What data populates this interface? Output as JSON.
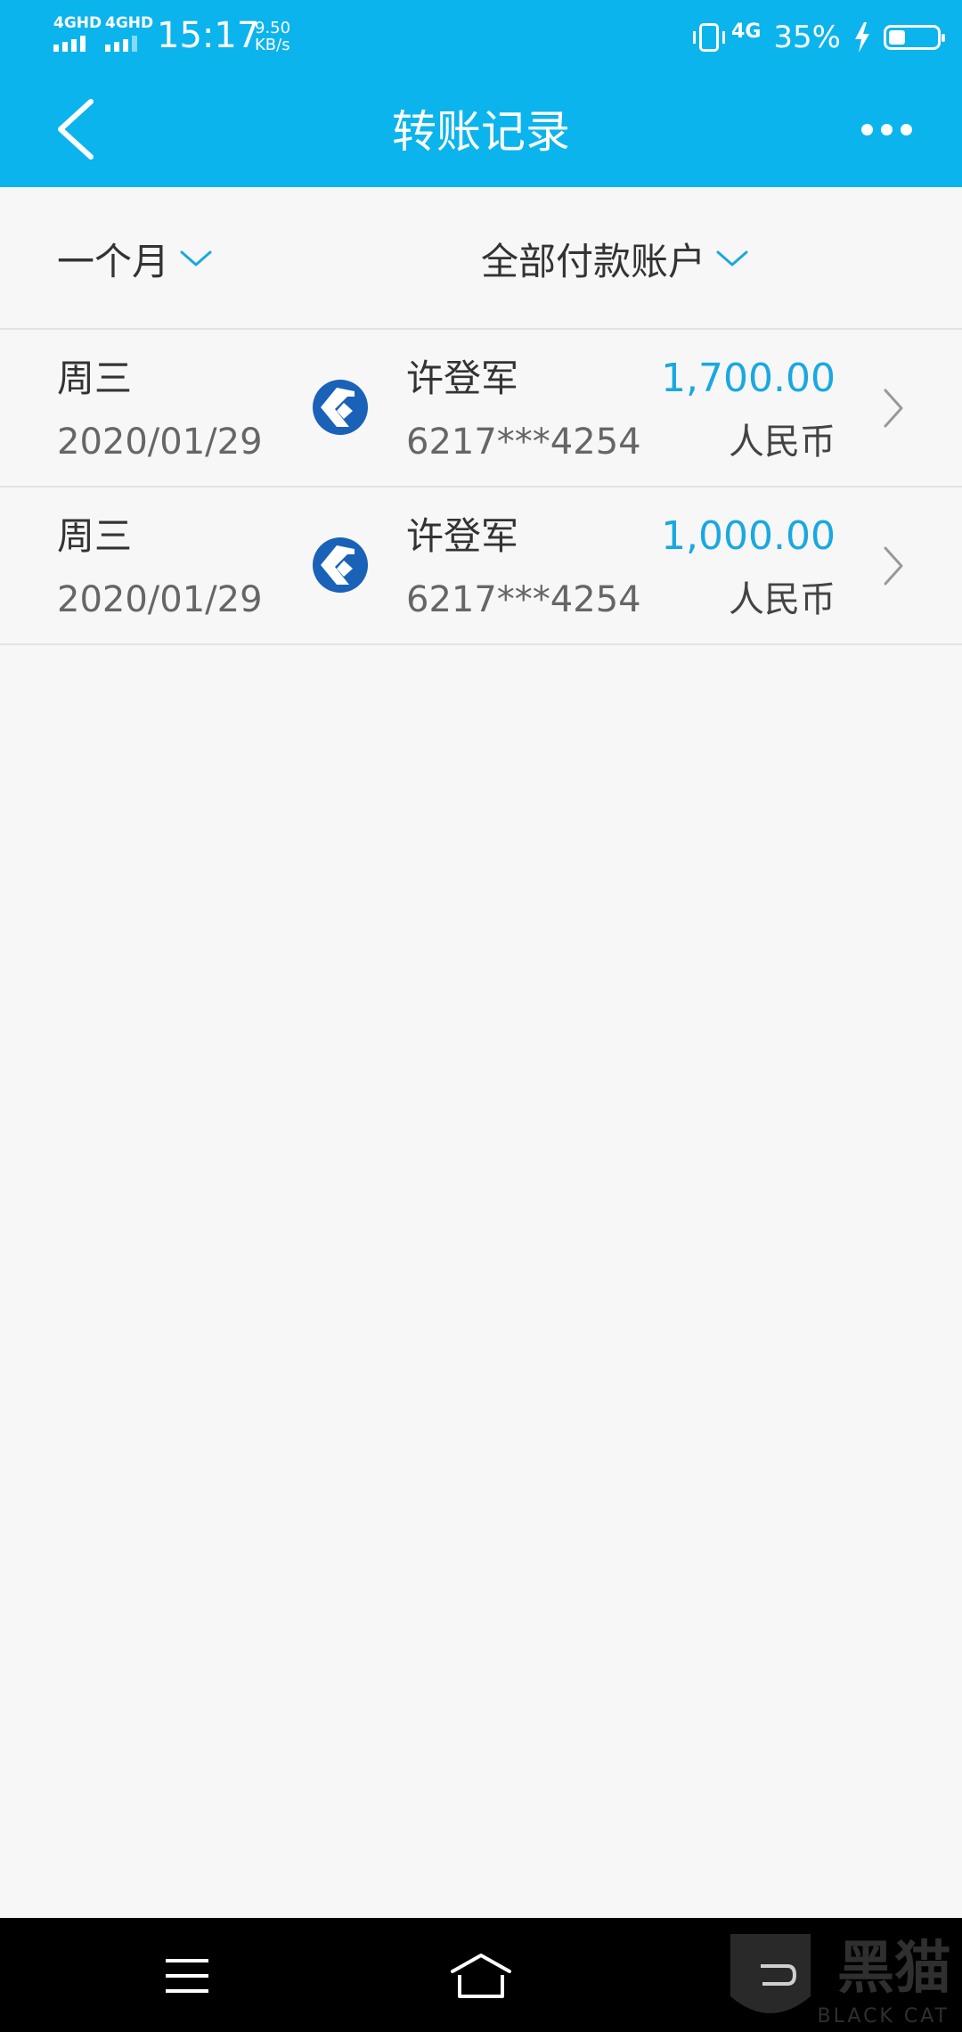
{
  "status_bar": {
    "sim1_label": "4GHD",
    "sim2_label": "4GHD",
    "time": "15:17",
    "speed_value": "9.50",
    "speed_unit": "KB/s",
    "network": "4G",
    "battery_text": "35%",
    "battery_level": 0.35
  },
  "header": {
    "title": "转账记录",
    "back_icon": "chevron-left-icon",
    "more_icon": "more-horizontal-icon"
  },
  "filters": {
    "period_label": "一个月",
    "account_label": "全部付款账户"
  },
  "transfers": [
    {
      "weekday": "周三",
      "date": "2020/01/29",
      "payee": "许登军",
      "account": "6217***4254",
      "amount": "1,700.00",
      "currency": "人民币"
    },
    {
      "weekday": "周三",
      "date": "2020/01/29",
      "payee": "许登军",
      "account": "6217***4254",
      "amount": "1,000.00",
      "currency": "人民币"
    }
  ],
  "watermark": {
    "text": "黑猫",
    "sub": "BLACK CAT"
  },
  "colors": {
    "primary": "#0bb4ec",
    "amount": "#1aa8e0",
    "bank_logo": "#1a62b8",
    "background": "#f7f7f7"
  }
}
